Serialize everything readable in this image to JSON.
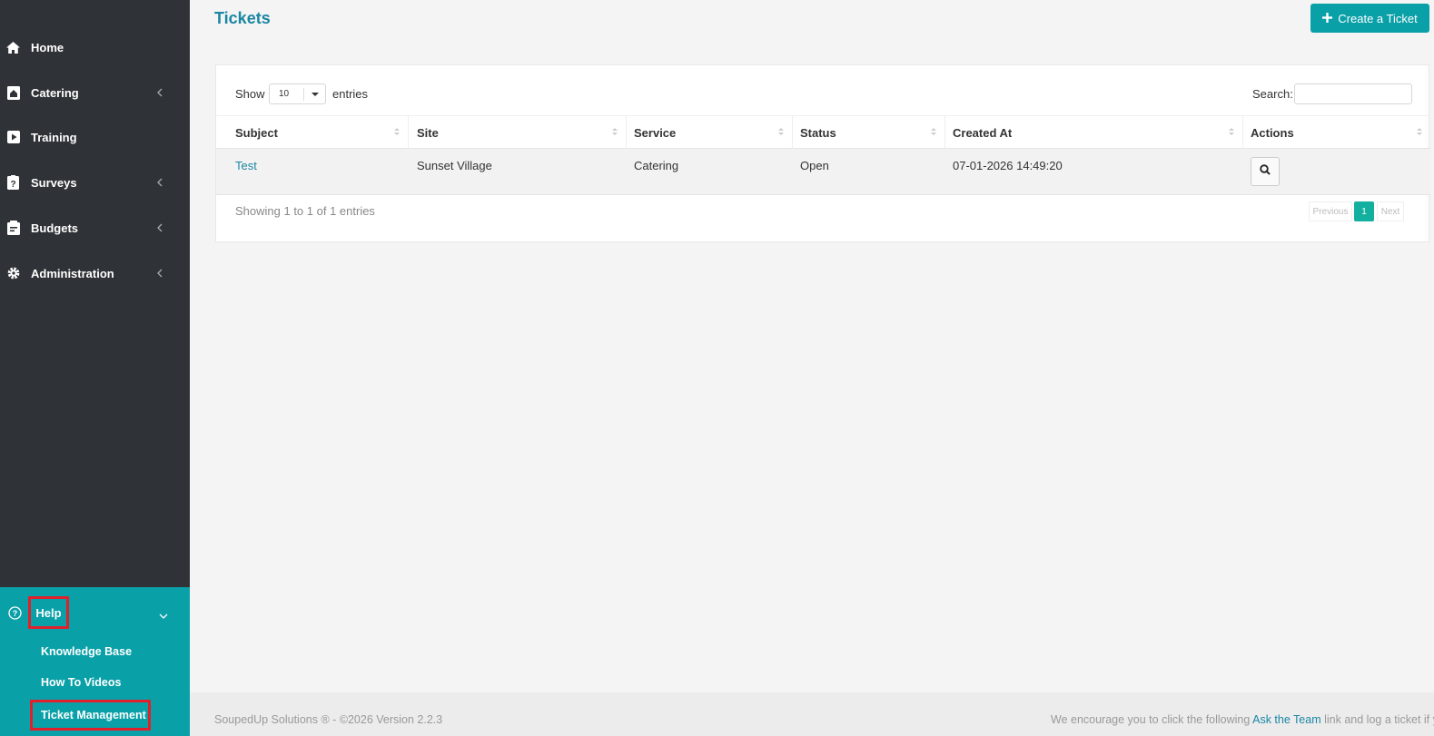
{
  "sidebar": {
    "items": [
      {
        "label": "Home",
        "icon": "home-icon"
      },
      {
        "label": "Catering",
        "icon": "catering-icon"
      },
      {
        "label": "Training",
        "icon": "play-icon"
      },
      {
        "label": "Surveys",
        "icon": "survey-icon"
      },
      {
        "label": "Budgets",
        "icon": "budget-icon"
      },
      {
        "label": "Administration",
        "icon": "gear-icon"
      }
    ],
    "help": {
      "label": "Help",
      "icon": "help-circle-icon",
      "sub_items": [
        {
          "label": "Knowledge Base"
        },
        {
          "label": "How To Videos"
        },
        {
          "label": "Ticket Management"
        }
      ]
    }
  },
  "page": {
    "title": "Tickets",
    "create_label": "Create a Ticket"
  },
  "table": {
    "show_label": "Show",
    "length_value": "10",
    "entries_label": "entries",
    "search_label": "Search:",
    "columns": [
      "Subject",
      "Site",
      "Service",
      "Status",
      "Created At",
      "Actions"
    ],
    "rows": [
      {
        "subject": "Test",
        "site": "Sunset Village",
        "service": "Catering",
        "status": "Open",
        "created_at": "07-01-2026 14:49:20"
      }
    ],
    "info": "Showing 1 to 1 of 1 entries",
    "pagination": {
      "previous": "Previous",
      "current": "1",
      "next": "Next"
    }
  },
  "footer": {
    "left": "SoupedUp Solutions ® - ©2026 Version 2.2.3",
    "right_prefix": "We encourage you to click the following ",
    "right_link": "Ask the Team",
    "right_suffix": " link and log a ticket if yo"
  },
  "colors": {
    "sidebar_bg": "#2f3337",
    "accent": "#0aa0a8",
    "title": "#1a86a3",
    "highlight_box": "#e0202a"
  }
}
